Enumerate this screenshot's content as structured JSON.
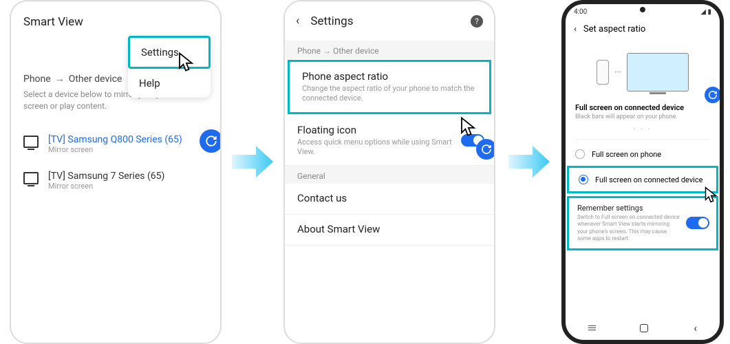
{
  "phone1": {
    "header": "Smart View",
    "menu": {
      "settings": "Settings",
      "help": "Help"
    },
    "section_prefix": "Phone",
    "section_suffix": "Other device",
    "description": "Select a device below to mirror your phone's screen or play content.",
    "devices": [
      {
        "name": "[TV] Samsung Q800 Series (65)",
        "sub": "Mirror screen"
      },
      {
        "name": "[TV] Samsung 7 Series (65)",
        "sub": "Mirror screen"
      }
    ]
  },
  "phone2": {
    "title": "Settings",
    "section1_prefix": "Phone",
    "section1_suffix": "Other device",
    "aspect": {
      "title": "Phone aspect ratio",
      "desc": "Change the aspect ratio of your phone to match the connected device."
    },
    "floating": {
      "title": "Floating icon",
      "desc": "Access quick menu options while using Smart View."
    },
    "section2": "General",
    "contact": "Contact us",
    "about": "About Smart View"
  },
  "phone3": {
    "status_time": "4:00",
    "title": "Set aspect ratio",
    "section_title": "Full screen on connected device",
    "section_desc": "Black bars will appear on your phone.",
    "radio1": "Full screen on phone",
    "radio2": "Full screen on connected device",
    "remember": {
      "title": "Remember settings",
      "desc": "Switch to Full screen on connected device whenever Smart View starts mirroring your phone's screen. This may cause some apps to restart."
    }
  }
}
